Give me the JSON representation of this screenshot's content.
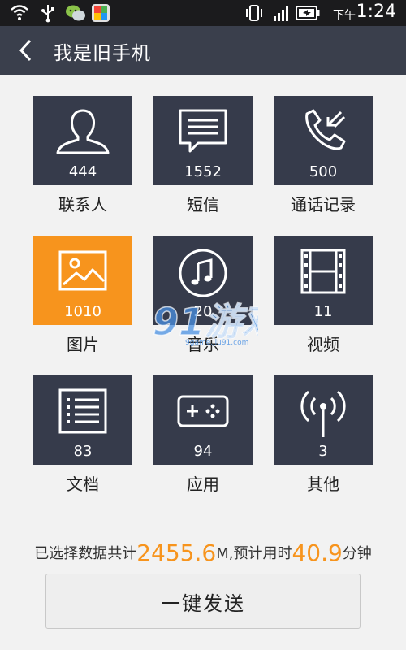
{
  "status_bar": {
    "ampm": "下午",
    "time": "1:24",
    "icons": [
      "wifi-icon",
      "usb-icon",
      "wechat-icon",
      "app-icon",
      "vibrate-icon",
      "signal-icon",
      "battery-icon"
    ]
  },
  "header": {
    "title": "我是旧手机",
    "back_icon": "chevron-left-icon"
  },
  "categories": [
    {
      "label": "联系人",
      "count": "444",
      "icon": "person-icon"
    },
    {
      "label": "短信",
      "count": "1552",
      "icon": "message-icon"
    },
    {
      "label": "通话记录",
      "count": "500",
      "icon": "phone-icon"
    },
    {
      "label": "图片",
      "count": "1010",
      "icon": "image-icon"
    },
    {
      "label": "音乐",
      "count": "20",
      "icon": "music-icon"
    },
    {
      "label": "视频",
      "count": "11",
      "icon": "film-icon"
    },
    {
      "label": "文档",
      "count": "83",
      "icon": "document-icon"
    },
    {
      "label": "应用",
      "count": "94",
      "icon": "gamepad-icon"
    },
    {
      "label": "其他",
      "count": "3",
      "icon": "antenna-icon"
    }
  ],
  "summary": {
    "prefix": "已选择数据共计",
    "size": "2455.6",
    "size_unit": "M,预计用时",
    "time": "40.9",
    "time_unit": "分钟"
  },
  "send_button": {
    "label": "一键发送"
  },
  "watermark": {
    "text": "91游戏",
    "sub": "9game.jiu91.com"
  },
  "colors": {
    "accent": "#f7941d",
    "tile": "#363b4b",
    "header": "#3a3f4c"
  }
}
